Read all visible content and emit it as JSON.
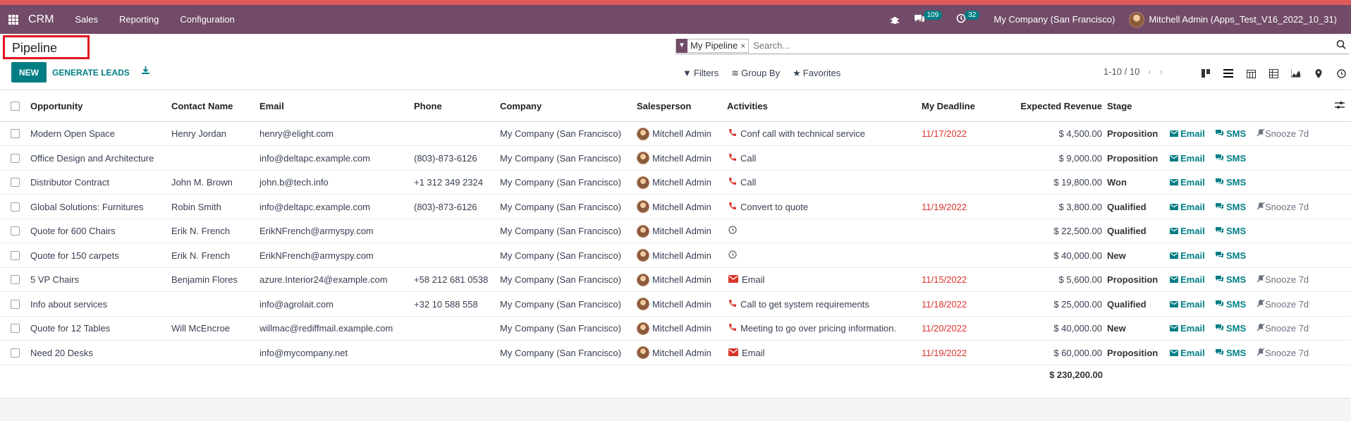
{
  "colors": {
    "brand": "#714b67",
    "accent": "#017e84",
    "deadline": "#d9342b",
    "highlight_box": "#e0141e"
  },
  "navbar": {
    "app_name": "CRM",
    "menus": [
      "Sales",
      "Reporting",
      "Configuration"
    ],
    "messages_count": "109",
    "activities_count": "32",
    "company": "My Company (San Francisco)",
    "user": "Mitchell Admin (Apps_Test_V16_2022_10_31)"
  },
  "panel": {
    "title": "Pipeline",
    "facet": "My Pipeline",
    "search_placeholder": "Search...",
    "new_label": "NEW",
    "generate_label": "GENERATE LEADS",
    "filters_label": "Filters",
    "groupby_label": "Group By",
    "favorites_label": "Favorites",
    "pager": "1-10 / 10",
    "views": [
      "kanban-icon",
      "list-icon",
      "calendar-icon",
      "pivot-icon",
      "graph-icon",
      "map-icon",
      "activity-icon"
    ]
  },
  "table": {
    "headers": {
      "opportunity": "Opportunity",
      "contact": "Contact Name",
      "email": "Email",
      "phone": "Phone",
      "company": "Company",
      "salesperson": "Salesperson",
      "activities": "Activities",
      "deadline": "My Deadline",
      "revenue": "Expected Revenue",
      "stage": "Stage"
    },
    "action_email": "Email",
    "action_sms": "SMS",
    "action_snooze": "Snooze 7d",
    "rows": [
      {
        "opportunity": "Modern Open Space",
        "contact": "Henry Jordan",
        "email": "henry@elight.com",
        "phone": "",
        "company": "My Company (San Francisco)",
        "salesperson": "Mitchell Admin",
        "activity_icon": "phone",
        "activity": "Conf call with technical service",
        "deadline": "11/17/2022",
        "revenue": "$ 4,500.00",
        "stage": "Proposition",
        "snooze": true
      },
      {
        "opportunity": "Office Design and Architecture",
        "contact": "",
        "email": "info@deltapc.example.com",
        "phone": "(803)-873-6126",
        "company": "My Company (San Francisco)",
        "salesperson": "Mitchell Admin",
        "activity_icon": "phone",
        "activity": "Call",
        "deadline": "",
        "revenue": "$ 9,000.00",
        "stage": "Proposition",
        "snooze": false
      },
      {
        "opportunity": "Distributor Contract",
        "contact": "John M. Brown",
        "email": "john.b@tech.info",
        "phone": "+1 312 349 2324",
        "company": "My Company (San Francisco)",
        "salesperson": "Mitchell Admin",
        "activity_icon": "phone",
        "activity": "Call",
        "deadline": "",
        "revenue": "$ 19,800.00",
        "stage": "Won",
        "snooze": false
      },
      {
        "opportunity": "Global Solutions: Furnitures",
        "contact": "Robin Smith",
        "email": "info@deltapc.example.com",
        "phone": "(803)-873-6126",
        "company": "My Company (San Francisco)",
        "salesperson": "Mitchell Admin",
        "activity_icon": "phone",
        "activity": "Convert to quote",
        "deadline": "11/19/2022",
        "revenue": "$ 3,800.00",
        "stage": "Qualified",
        "snooze": true
      },
      {
        "opportunity": "Quote for 600 Chairs",
        "contact": "Erik N. French",
        "email": "ErikNFrench@armyspy.com",
        "phone": "",
        "company": "My Company (San Francisco)",
        "salesperson": "Mitchell Admin",
        "activity_icon": "clock",
        "activity": "",
        "deadline": "",
        "revenue": "$ 22,500.00",
        "stage": "Qualified",
        "snooze": false
      },
      {
        "opportunity": "Quote for 150 carpets",
        "contact": "Erik N. French",
        "email": "ErikNFrench@armyspy.com",
        "phone": "",
        "company": "My Company (San Francisco)",
        "salesperson": "Mitchell Admin",
        "activity_icon": "clock",
        "activity": "",
        "deadline": "",
        "revenue": "$ 40,000.00",
        "stage": "New",
        "snooze": false
      },
      {
        "opportunity": "5 VP Chairs",
        "contact": "Benjamin Flores",
        "email": "azure.Interior24@example.com",
        "phone": "+58 212 681 0538",
        "company": "My Company (San Francisco)",
        "salesperson": "Mitchell Admin",
        "activity_icon": "mail",
        "activity": "Email",
        "deadline": "11/15/2022",
        "revenue": "$ 5,600.00",
        "stage": "Proposition",
        "snooze": true
      },
      {
        "opportunity": "Info about services",
        "contact": "",
        "email": "info@agrolait.com",
        "phone": "+32 10 588 558",
        "company": "My Company (San Francisco)",
        "salesperson": "Mitchell Admin",
        "activity_icon": "phone",
        "activity": "Call to get system requirements",
        "deadline": "11/18/2022",
        "revenue": "$ 25,000.00",
        "stage": "Qualified",
        "snooze": true
      },
      {
        "opportunity": "Quote for 12 Tables",
        "contact": "Will McEncroe",
        "email": "willmac@rediffmail.example.com",
        "phone": "",
        "company": "My Company (San Francisco)",
        "salesperson": "Mitchell Admin",
        "activity_icon": "phone",
        "activity": "Meeting to go over pricing information.",
        "deadline": "11/20/2022",
        "revenue": "$ 40,000.00",
        "stage": "New",
        "snooze": true
      },
      {
        "opportunity": "Need 20 Desks",
        "contact": "",
        "email": "info@mycompany.net",
        "phone": "",
        "company": "My Company (San Francisco)",
        "salesperson": "Mitchell Admin",
        "activity_icon": "mail",
        "activity": "Email",
        "deadline": "11/19/2022",
        "revenue": "$ 60,000.00",
        "stage": "Proposition",
        "snooze": true
      }
    ],
    "total_revenue": "$ 230,200.00"
  }
}
